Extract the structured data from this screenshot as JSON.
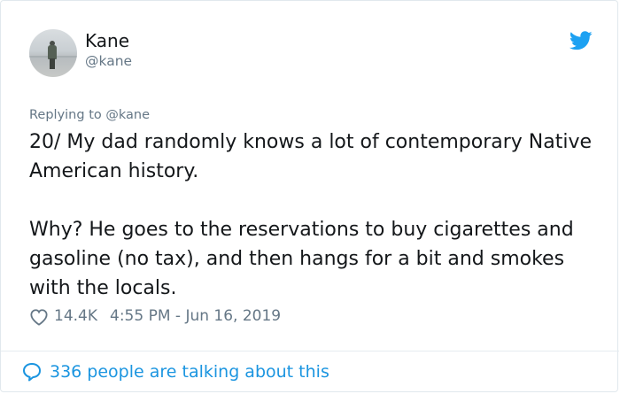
{
  "tweet": {
    "author_name": "Kane",
    "author_handle": "@kane",
    "replying_to": "Replying to @kane",
    "paragraph_1": "20/ My dad randomly knows a lot of contemporary Native American history.",
    "paragraph_2": "Why? He goes to the reservations to buy cigarettes and gasoline (no tax), and then hangs for a bit and smokes with the locals.",
    "likes": "14.4K",
    "timestamp": "4:55 PM - Jun 16, 2019",
    "talking": "336 people are talking about this"
  },
  "icons": {
    "brand": "twitter-bird-icon",
    "like": "heart-icon",
    "reply": "speech-bubble-icon"
  },
  "colors": {
    "brand": "#1da1f2",
    "link": "#1b95e0",
    "muted": "#657786",
    "text": "#14171a"
  }
}
